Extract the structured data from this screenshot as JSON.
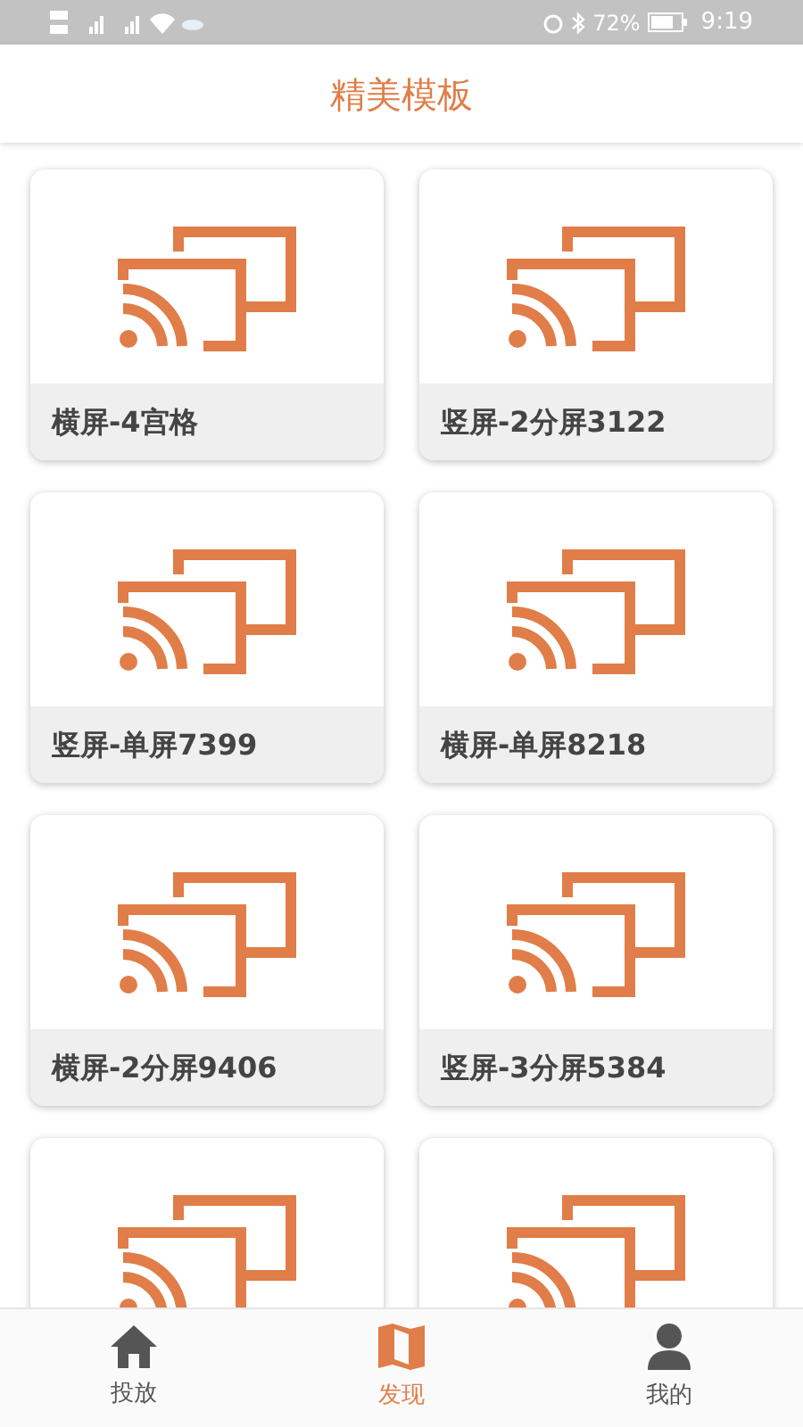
{
  "status_bar": {
    "battery": "72%",
    "time": "9:19"
  },
  "header": {
    "title": "精美模板"
  },
  "templates": [
    {
      "kind": "labeled",
      "name": "横屏-4宫格"
    },
    {
      "kind": "labeled",
      "name": "竖屏-2分屏3122"
    },
    {
      "kind": "labeled",
      "name": "竖屏-单屏7399"
    },
    {
      "kind": "labeled",
      "name": "横屏-单屏8218"
    },
    {
      "kind": "labeled",
      "name": "横屏-2分屏9406"
    },
    {
      "kind": "labeled",
      "name": "竖屏-3分屏5384"
    },
    {
      "kind": "cut_off"
    },
    {
      "kind": "cut_off"
    }
  ],
  "bottom_nav": [
    {
      "kind": "home",
      "label": "投放",
      "selected": false
    },
    {
      "kind": "map",
      "label": "发现",
      "selected": true
    },
    {
      "kind": "person",
      "label": "我的",
      "selected": false
    }
  ]
}
